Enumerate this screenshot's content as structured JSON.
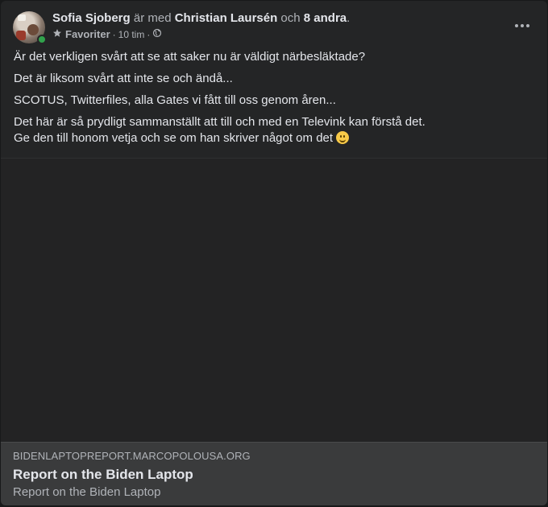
{
  "post": {
    "author": "Sofia Sjoberg",
    "with_word": "är med",
    "tagged": "Christian Laursén",
    "and_word": "och",
    "others": "8 andra",
    "period": ".",
    "audience_label": "Favoriter",
    "timestamp": "10 tim",
    "separator": "·",
    "paragraphs": [
      "Är det verkligen svårt att se att saker nu är väldigt närbesläktade?",
      "Det är liksom svårt att inte se och ändå...",
      "SCOTUS, Twitterfiles, alla Gates vi fått till oss genom åren...",
      "Det här är så prydligt sammanställt att till och med en Televink kan förstå det."
    ],
    "last_line": "Ge den till honom vetja och se om han skriver något om det",
    "icons": {
      "star": "star-icon",
      "globe": "globe-icon",
      "more": "more-options-icon",
      "emoji": "smiling-face-emoji"
    }
  },
  "link_preview": {
    "domain": "BIDENLAPTOPREPORT.MARCOPOLOUSA.ORG",
    "title": "Report on the Biden Laptop",
    "description": "Report on the Biden Laptop"
  },
  "colors": {
    "background": "#242526",
    "text_primary": "#e4e6eb",
    "text_secondary": "#b0b3b8",
    "online": "#31a24c",
    "preview_bg": "#3a3b3c"
  }
}
